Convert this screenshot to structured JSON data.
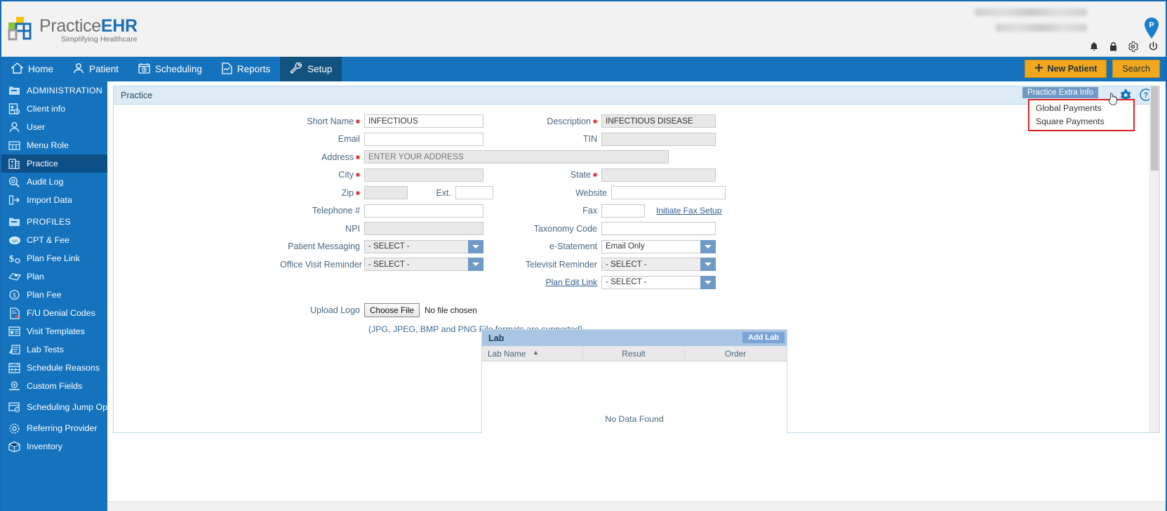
{
  "brand": {
    "name_prefix": "Practice",
    "name_suffix": "EHR",
    "tagline": "Simplifying Healthcare",
    "accent_blue": "#1573bd",
    "accent_gold": "#f0a81e",
    "required_red": "#e03b2f"
  },
  "header": {
    "icons": [
      "bell-icon",
      "lock-icon",
      "gear-icon",
      "power-icon"
    ],
    "pin_letter": "P"
  },
  "nav": {
    "items": [
      {
        "label": "Home",
        "icon": "home-icon",
        "active": false
      },
      {
        "label": "Patient",
        "icon": "person-icon",
        "active": false
      },
      {
        "label": "Scheduling",
        "icon": "calendar-clock-icon",
        "active": false
      },
      {
        "label": "Reports",
        "icon": "report-icon",
        "active": false
      },
      {
        "label": "Setup",
        "icon": "wrench-icon",
        "active": true
      }
    ],
    "new_patient_label": "New Patient",
    "search_label": "Search"
  },
  "sidebar": {
    "items": [
      {
        "label": "ADMINISTRATION",
        "icon": "folder-icon",
        "group": true,
        "active": false
      },
      {
        "label": "Client info",
        "icon": "client-info-icon",
        "group": false,
        "active": false
      },
      {
        "label": "User",
        "icon": "user-icon",
        "group": false,
        "active": false
      },
      {
        "label": "Menu Role",
        "icon": "menu-role-icon",
        "group": false,
        "active": false
      },
      {
        "label": "Practice",
        "icon": "practice-icon",
        "group": false,
        "active": true
      },
      {
        "label": "Audit Log",
        "icon": "audit-log-icon",
        "group": false,
        "active": false
      },
      {
        "label": "Import Data",
        "icon": "import-data-icon",
        "group": false,
        "active": false
      },
      {
        "label": "PROFILES",
        "icon": "folder-icon",
        "group": true,
        "active": false
      },
      {
        "label": "CPT & Fee",
        "icon": "cpt-icon",
        "group": false,
        "active": false
      },
      {
        "label": "Plan Fee Link",
        "icon": "plan-fee-link-icon",
        "group": false,
        "active": false
      },
      {
        "label": "Plan",
        "icon": "plan-icon",
        "group": false,
        "active": false
      },
      {
        "label": "Plan Fee",
        "icon": "plan-fee-icon",
        "group": false,
        "active": false
      },
      {
        "label": "F/U Denial Codes",
        "icon": "denial-codes-icon",
        "group": false,
        "active": false
      },
      {
        "label": "Visit Templates",
        "icon": "visit-templates-icon",
        "group": false,
        "active": false
      },
      {
        "label": "Lab Tests",
        "icon": "lab-tests-icon",
        "group": false,
        "active": false
      },
      {
        "label": "Schedule Reasons",
        "icon": "schedule-reasons-icon",
        "group": false,
        "active": false
      },
      {
        "label": "Custom Fields",
        "icon": "custom-fields-icon",
        "group": false,
        "active": false
      },
      {
        "label": "Scheduling Jump Option",
        "icon": "scheduling-jump-icon",
        "group": false,
        "active": false,
        "tall": true
      },
      {
        "label": "Referring Provider",
        "icon": "referring-provider-icon",
        "group": false,
        "active": false
      },
      {
        "label": "Inventory",
        "icon": "inventory-icon",
        "group": false,
        "active": false
      }
    ]
  },
  "panel": {
    "title": "Practice",
    "tooltip": "Practice Extra Info",
    "extra_menu": [
      "Global Payments",
      "Square Payments"
    ],
    "gear_icon": "gear-icon",
    "help_icon": "help-icon"
  },
  "form": {
    "short_name": {
      "label": "Short Name",
      "value": "INFECTIOUS",
      "required": true
    },
    "description": {
      "label": "Description",
      "value": "INFECTIOUS DISEASE",
      "required": true
    },
    "email": {
      "label": "Email",
      "value": "",
      "required": false
    },
    "tin": {
      "label": "TIN",
      "value": "",
      "required": false
    },
    "address": {
      "label": "Address",
      "value": "",
      "placeholder": "ENTER YOUR ADDRESS",
      "required": true
    },
    "city": {
      "label": "City",
      "value": "",
      "required": true
    },
    "state": {
      "label": "State",
      "value": "",
      "required": true
    },
    "zip": {
      "label": "Zip",
      "value": "",
      "required": true
    },
    "ext": {
      "label": "Ext.",
      "value": "",
      "required": false
    },
    "website": {
      "label": "Website",
      "value": "",
      "required": false
    },
    "telephone": {
      "label": "Telephone #",
      "value": "",
      "required": false
    },
    "fax": {
      "label": "Fax",
      "value": "",
      "required": false
    },
    "initiate_fax_setup": {
      "label": "Initiate Fax Setup"
    },
    "npi": {
      "label": "NPI",
      "value": "",
      "required": false
    },
    "taxonomy_code": {
      "label": "Taxonomy Code",
      "value": "",
      "required": false
    },
    "patient_messaging": {
      "label": "Patient Messaging",
      "value": "- SELECT -"
    },
    "e_statement": {
      "label": "e-Statement",
      "value": "Email Only"
    },
    "office_visit_reminder": {
      "label": "Office Visit Reminder",
      "value": "- SELECT -"
    },
    "televisit_reminder": {
      "label": "Televisit Reminder",
      "value": "- SELECT -"
    },
    "plan_edit_link": {
      "label": "Plan Edit Link",
      "value": "- SELECT -"
    },
    "upload_logo": {
      "label": "Upload Logo",
      "button": "Choose File",
      "status": "No file chosen",
      "hint": "(JPG, JPEG, BMP and PNG File formats are supported)"
    }
  },
  "lab_table": {
    "title": "Lab",
    "add_button": "Add Lab",
    "columns": [
      "Lab Name",
      "Result",
      "Order"
    ],
    "rows": [],
    "empty_message": "No Data Found"
  }
}
